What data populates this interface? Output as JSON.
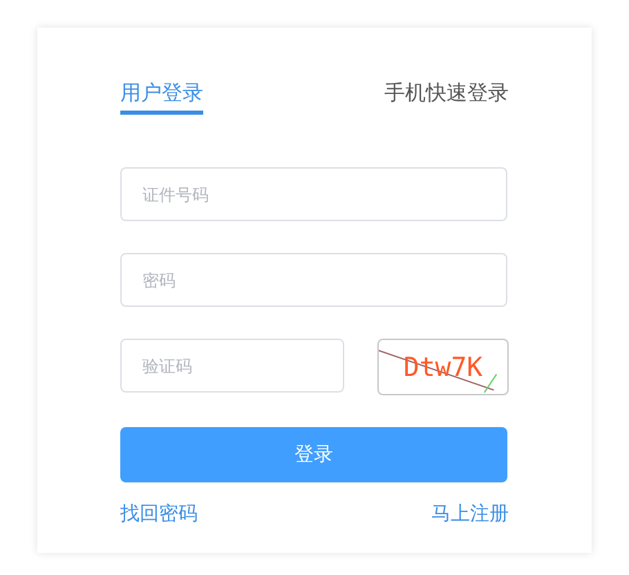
{
  "tabs": [
    {
      "label": "用户登录",
      "selected": true
    },
    {
      "label": "手机快速登录",
      "selected": false
    }
  ],
  "fields": [
    {
      "placeholder": "证件号码"
    },
    {
      "placeholder": "密码"
    }
  ],
  "captcha_field": {
    "placeholder": "验证码"
  },
  "captcha": {
    "text": "Dtw7K"
  },
  "login_button": "登录",
  "links": [
    "找回密码",
    "马上注册"
  ]
}
